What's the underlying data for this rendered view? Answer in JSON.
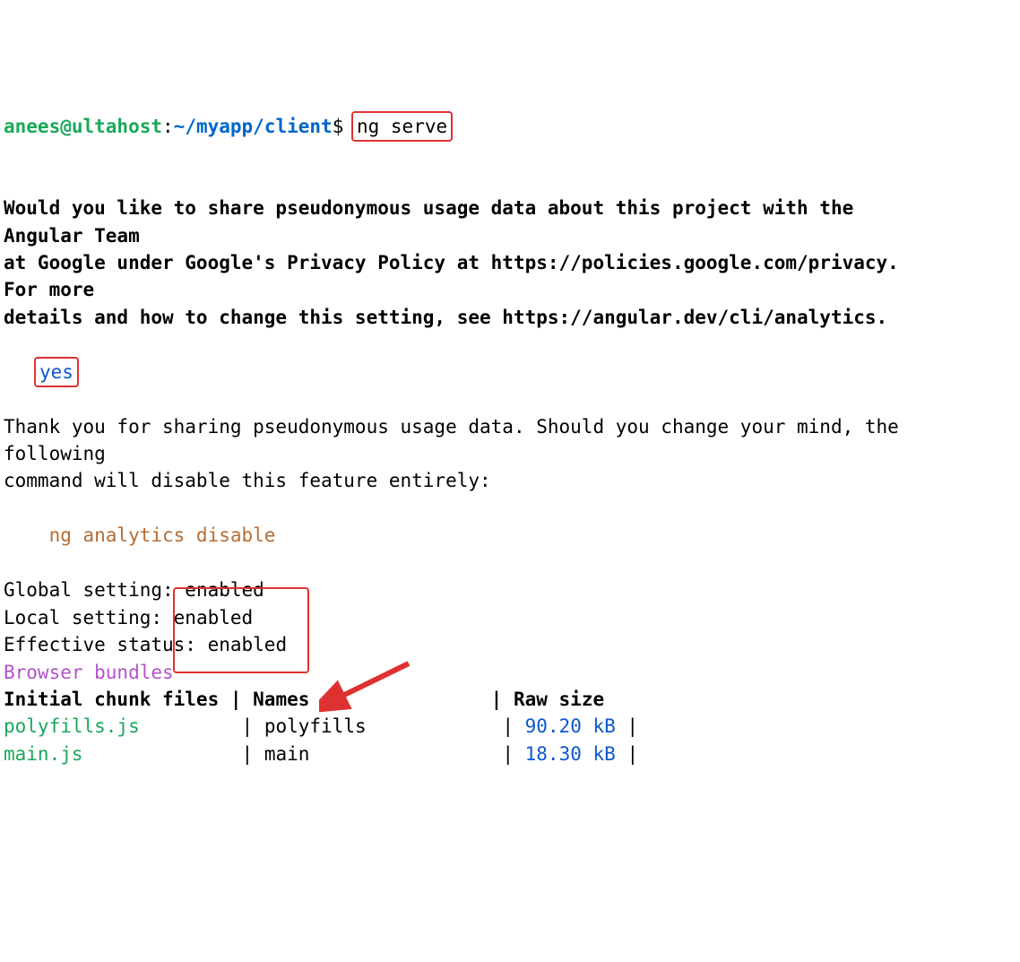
{
  "prompt": {
    "user": "anees@ultahost",
    "sep1": ":",
    "path": "~/myapp/client",
    "sep2": "$ ",
    "command": "ng serve"
  },
  "question_line1": "Would you like to share pseudonymous usage data about this project with the",
  "question_line2": "Angular Team",
  "question_line3": "at Google under Google's Privacy Policy at https://policies.google.com/privacy.",
  "question_line4": "For more",
  "question_line5": "details and how to change this setting, see https://angular.dev/cli/analytics.",
  "answer": "yes",
  "thankyou_line1": "Thank you for sharing pseudonymous usage data. Should you change your mind, the",
  "thankyou_line2": "following",
  "thankyou_line3": "command will disable this feature entirely:",
  "disable_command": "    ng analytics disable",
  "settings": {
    "global_label": "Global setting:",
    "global_val": " enabled",
    "local_label": "Local setting: ",
    "local_val": "enabled",
    "effective_label": "Effective statu",
    "effective_mid": "s: ",
    "effective_val": "enabled"
  },
  "bundles_heading": "Browser bundles",
  "table": {
    "header_col1": "Initial chunk files",
    "header_col2": "Names",
    "header_col3": "Raw size",
    "sep": " | ",
    "rows": [
      {
        "file": "polyfills.js",
        "pad1": "        ",
        "name": "polyfills",
        "pad2": "           ",
        "size": "90.20 kB",
        "tail": " | "
      },
      {
        "file": "main.js",
        "pad1": "             ",
        "name": "main",
        "pad2": "                ",
        "size": "18.30 kB",
        "tail": " | "
      }
    ]
  }
}
